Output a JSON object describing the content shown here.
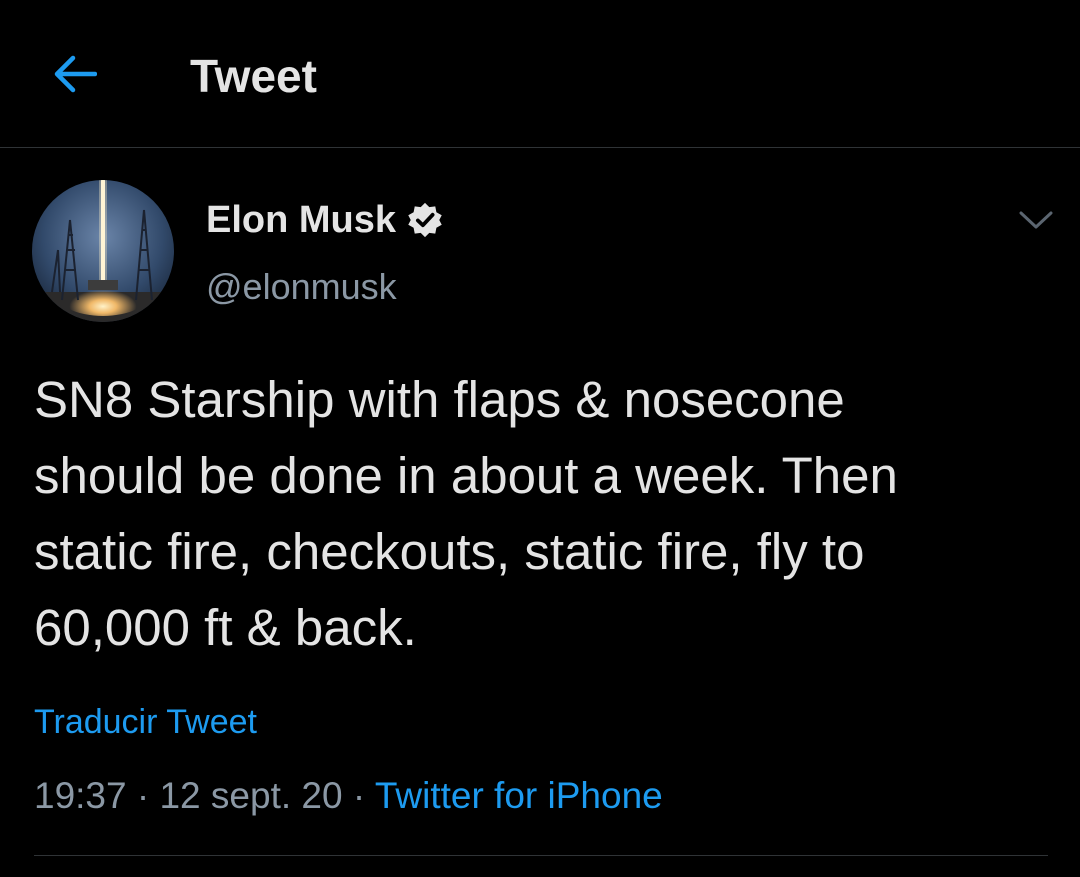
{
  "header": {
    "title": "Tweet",
    "back_icon": "arrow-left-icon"
  },
  "author": {
    "display_name": "Elon Musk",
    "handle": "@elonmusk",
    "verified_icon": "verified-badge-icon",
    "avatar": "rocket-launch-avatar"
  },
  "tweet": {
    "text": "SN8 Starship with flaps & nosecone\nshould be done in about a week. Then\nstatic fire, checkouts, static fire, fly to\n60,000 ft & back.",
    "translate_label": "Traducir Tweet",
    "time": "19:37",
    "separator": "·",
    "date": "12 sept. 20",
    "source": "Twitter for iPhone",
    "more_icon": "chevron-down-icon"
  },
  "colors": {
    "background": "#000000",
    "accent": "#1d9bf0",
    "text_primary": "#e4e4e4",
    "text_secondary": "#8b98a5",
    "divider": "#2f3336"
  }
}
